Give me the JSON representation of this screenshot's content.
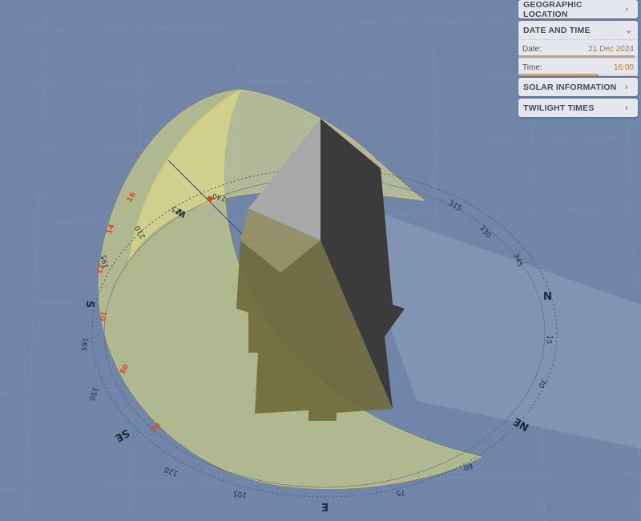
{
  "panels": {
    "geographic_location": {
      "title": "GEOGRAPHIC LOCATION"
    },
    "date_and_time": {
      "title": "DATE AND TIME",
      "date_label": "Date:",
      "date_value": "21 Dec 2024",
      "date_progress": 0.97,
      "time_label": "Time:",
      "time_value": "16:00",
      "time_progress": 0.67
    },
    "solar_information": {
      "title": "SOLAR INFORMATION"
    },
    "twilight_times": {
      "title": "TWILIGHT TIMES"
    }
  },
  "compass": {
    "cardinals": [
      "N",
      "NE",
      "E",
      "SE",
      "S",
      "W"
    ],
    "degree_labels": [
      "15",
      "30",
      "60",
      "75",
      "105",
      "120",
      "150",
      "165",
      "315",
      "330",
      "345",
      "195",
      "210",
      "225",
      "240"
    ]
  },
  "sun_path": {
    "hour_labels": [
      "06",
      "08",
      "10",
      "12",
      "14",
      "16"
    ]
  },
  "colors": {
    "background": "#6f86a8",
    "sun_path_fill": "#e5e27a",
    "building_light": "#9b9b9b",
    "building_dark": "#3a3a3a",
    "accent": "#c3a17d"
  }
}
